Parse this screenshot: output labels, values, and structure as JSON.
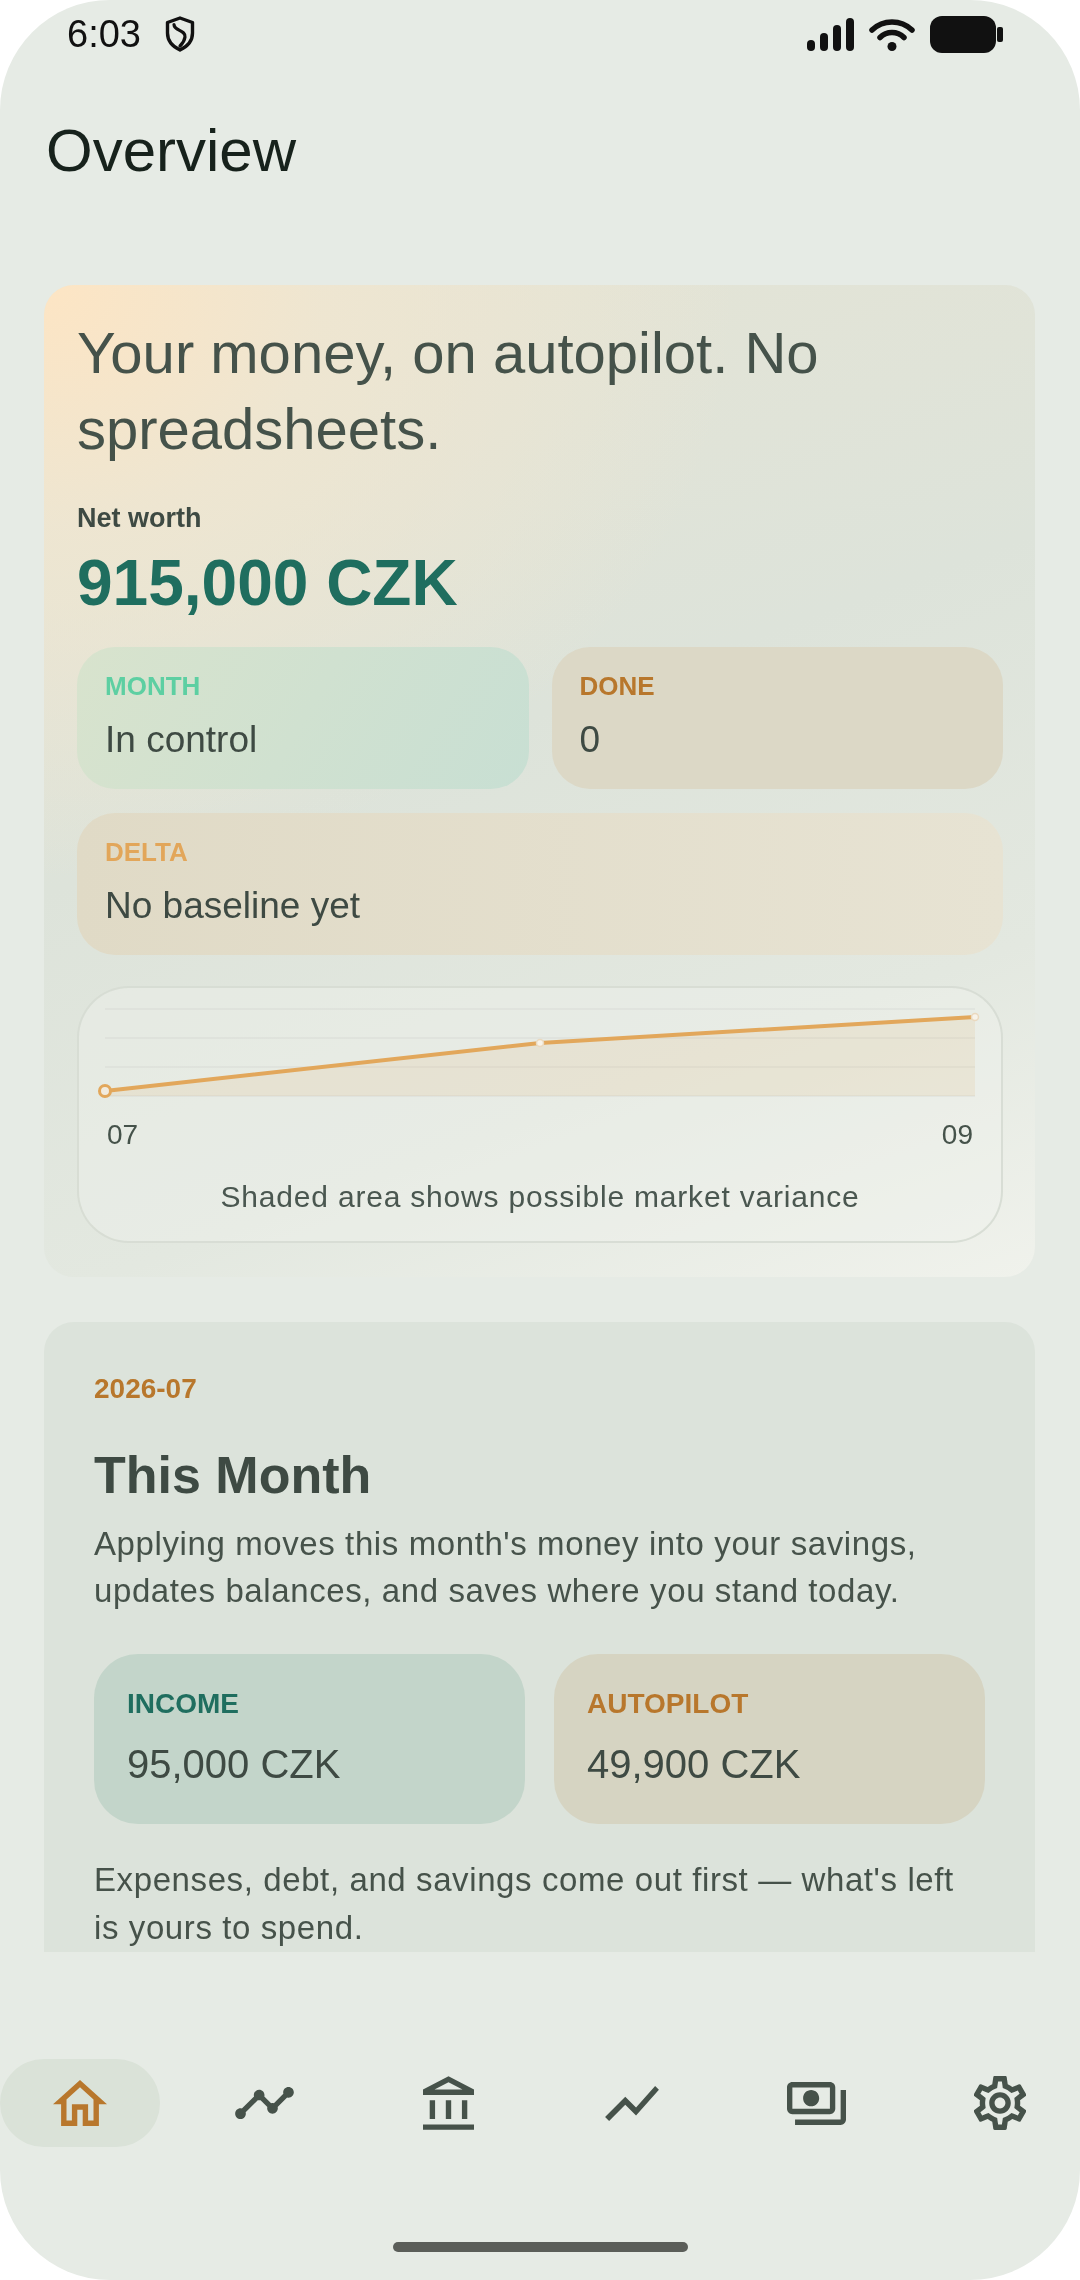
{
  "status_bar": {
    "time": "6:03"
  },
  "screen": {
    "title": "Overview"
  },
  "hero": {
    "headline": "Your money, on autopilot. No spreadsheets.",
    "net_worth_label": "Net worth",
    "net_worth": "915,000 CZK",
    "stats": [
      {
        "kind": "status",
        "label": "MONTH",
        "value": "In control"
      },
      {
        "kind": "count",
        "label": "DONE",
        "value": "0"
      },
      {
        "kind": "delta",
        "label": "DELTA",
        "value": "No baseline yet"
      }
    ],
    "chart": {
      "x_labels": [
        "07",
        "09"
      ],
      "caption": "Shaded area shows possible market variance"
    }
  },
  "this_month": {
    "period": "2026-07",
    "title": "This Month",
    "description": "Applying moves this month's money into your savings, updates balances, and saves where you stand today.",
    "totals": [
      {
        "kind": "income",
        "label": "INCOME",
        "value": "95,000 CZK"
      },
      {
        "kind": "autopilot",
        "label": "AUTOPILOT",
        "value": "49,900 CZK"
      }
    ],
    "note": "Expenses, debt, and savings come out first — what's left is yours to spend."
  },
  "bottom_nav": [
    {
      "kind": "home",
      "selected": true
    },
    {
      "kind": "timeline",
      "selected": false
    },
    {
      "kind": "bank",
      "selected": false
    },
    {
      "kind": "trend",
      "selected": false
    },
    {
      "kind": "cash",
      "selected": false
    },
    {
      "kind": "settings",
      "selected": false
    }
  ]
}
